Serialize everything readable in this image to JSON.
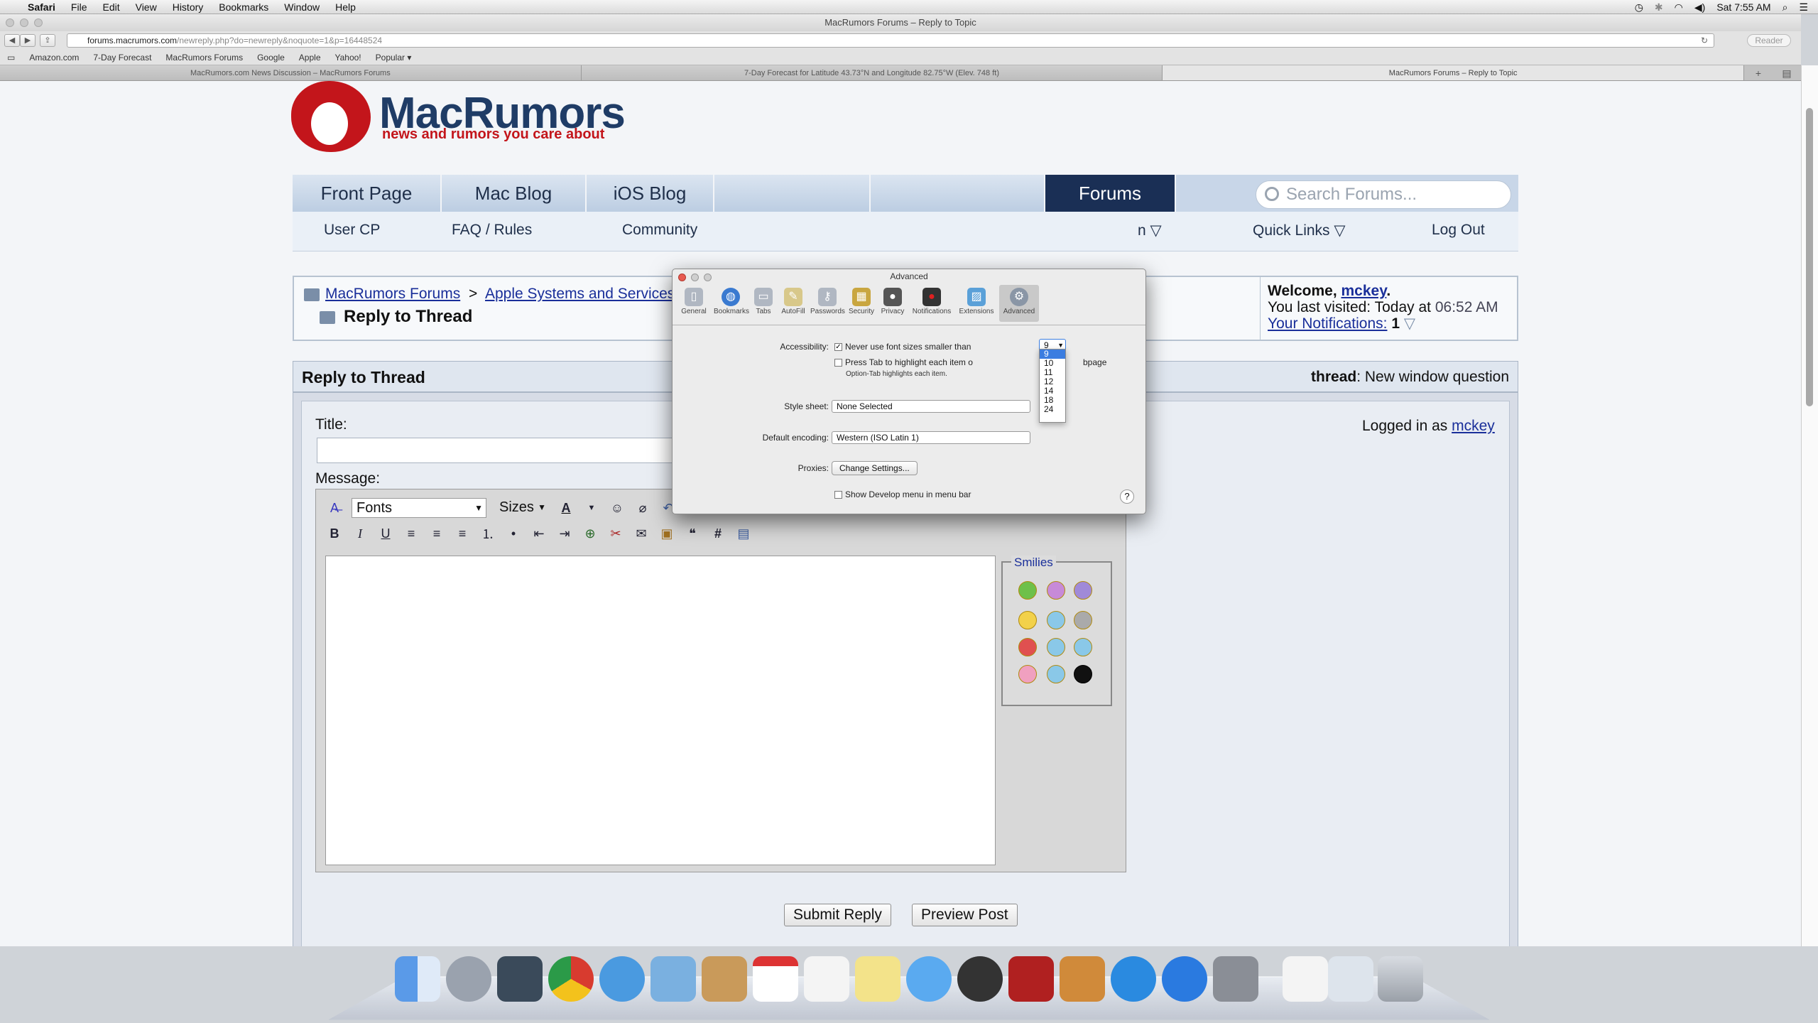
{
  "menubar": {
    "app": "Safari",
    "items": [
      "File",
      "Edit",
      "View",
      "History",
      "Bookmarks",
      "Window",
      "Help"
    ],
    "clock": "Sat 7:55 AM"
  },
  "window": {
    "title": "MacRumors Forums – Reply to Topic",
    "url_host": "forums.macrumors.com",
    "url_path": "/newreply.php?do=newreply&noquote=1&p=16448524",
    "reader": "Reader"
  },
  "bookmarks": [
    "Amazon.com",
    "7-Day Forecast",
    "MacRumors Forums",
    "Google",
    "Apple",
    "Yahoo!",
    "Popular ▾"
  ],
  "tabs": [
    {
      "label": "MacRumors.com News Discussion – MacRumors Forums",
      "active": false
    },
    {
      "label": "7-Day Forecast for Latitude 43.73°N and Longitude 82.75°W (Elev. 748 ft)",
      "active": false
    },
    {
      "label": "MacRumors Forums – Reply to Topic",
      "active": true
    }
  ],
  "site": {
    "brand": "MacRumors",
    "tagline": "news and rumors you care about",
    "nav_top": [
      "Front Page",
      "Mac Blog",
      "iOS Blog",
      "Forums"
    ],
    "search_placeholder": "Search Forums...",
    "nav_sub": [
      "User CP",
      "FAQ / Rules",
      "Community",
      "Quick Links ▽",
      "Log Out"
    ],
    "nav_sub_partial": "n ▽"
  },
  "breadcrumb": {
    "root": "MacRumors Forums",
    "sep": ">",
    "section": "Apple Systems and Services",
    "current": "Reply to Thread"
  },
  "welcome": {
    "prefix": "Welcome, ",
    "user": "mckey",
    "suffix": ".",
    "visited_label": "You last visited: Today at",
    "visited_time": "06:52 AM",
    "notifications_label": "Your Notifications:",
    "notifications_count": "1"
  },
  "reply": {
    "header": "Reply to Thread",
    "thread_label": "thread",
    "thread_title": "New window question",
    "title_label": "Title:",
    "message_label": "Message:",
    "logged_in_as": "Logged in as",
    "user": "mckey",
    "fonts": "Fonts",
    "sizes": "Sizes",
    "smilies_legend": "Smilies",
    "submit": "Submit Reply",
    "preview": "Preview Post"
  },
  "prefs": {
    "title": "Advanced",
    "tabs": [
      "General",
      "Bookmarks",
      "Tabs",
      "AutoFill",
      "Passwords",
      "Security",
      "Privacy",
      "Notifications",
      "Extensions",
      "Advanced"
    ],
    "accessibility_label": "Accessibility:",
    "never_font_label": "Never use font sizes smaller than",
    "min_font_value": "9",
    "press_tab_label": "Press Tab to highlight each item on a webpage",
    "press_tab_visible_start": "Press Tab to highlight each item o",
    "press_tab_visible_end": "bpage",
    "option_tab_note": "Option-Tab highlights each item.",
    "stylesheet_label": "Style sheet:",
    "stylesheet_value": "None Selected",
    "encoding_label": "Default encoding:",
    "encoding_value": "Western (ISO Latin 1)",
    "proxies_label": "Proxies:",
    "proxies_button": "Change Settings...",
    "develop_label": "Show Develop menu in menu bar",
    "help": "?",
    "font_options": [
      "9",
      "10",
      "11",
      "12",
      "14",
      "18",
      "24"
    ],
    "selected_option": "9"
  }
}
